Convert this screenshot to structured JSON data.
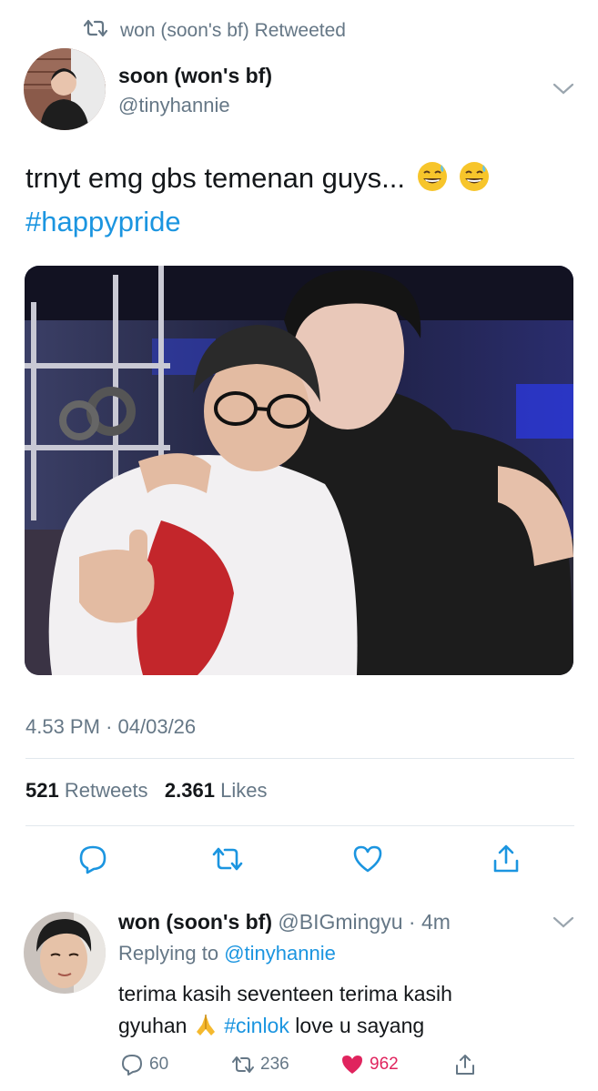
{
  "retweet_banner": {
    "text": "won (soon's bf) Retweeted"
  },
  "main_tweet": {
    "author_name": "soon (won's bf)",
    "author_handle": "@tinyhannie",
    "text": "trnyt emg gbs temenan guys...",
    "hashtag": "#happypride",
    "timestamp": "4.53 PM",
    "date": "04/03/26",
    "retweets_count": "521",
    "retweets_label": "Retweets",
    "likes_count": "2.361",
    "likes_label": "Likes"
  },
  "reply_tweet": {
    "author_name": "won (soon's bf)",
    "author_handle": "@BIGmingyu",
    "time_ago": "4m",
    "replying_to_label": "Replying to",
    "replying_to_handle": "@tinyhannie",
    "text_line1": "terima kasih seventeen terima kasih",
    "text_line2_start": "gyuhan",
    "hashtag": "#cinlok",
    "text_line2_end": "love u sayang",
    "reply_count": "60",
    "retweet_count": "236",
    "like_count": "962"
  },
  "colors": {
    "link": "#1b95e0",
    "secondary": "#657786",
    "like": "#e0245e",
    "divider": "#e1e8ed"
  },
  "icons": [
    "retweet-icon",
    "chevron-down-icon",
    "reply-icon",
    "like-icon",
    "share-icon",
    "praying-hands-icon",
    "sweat-smile-emoji"
  ]
}
